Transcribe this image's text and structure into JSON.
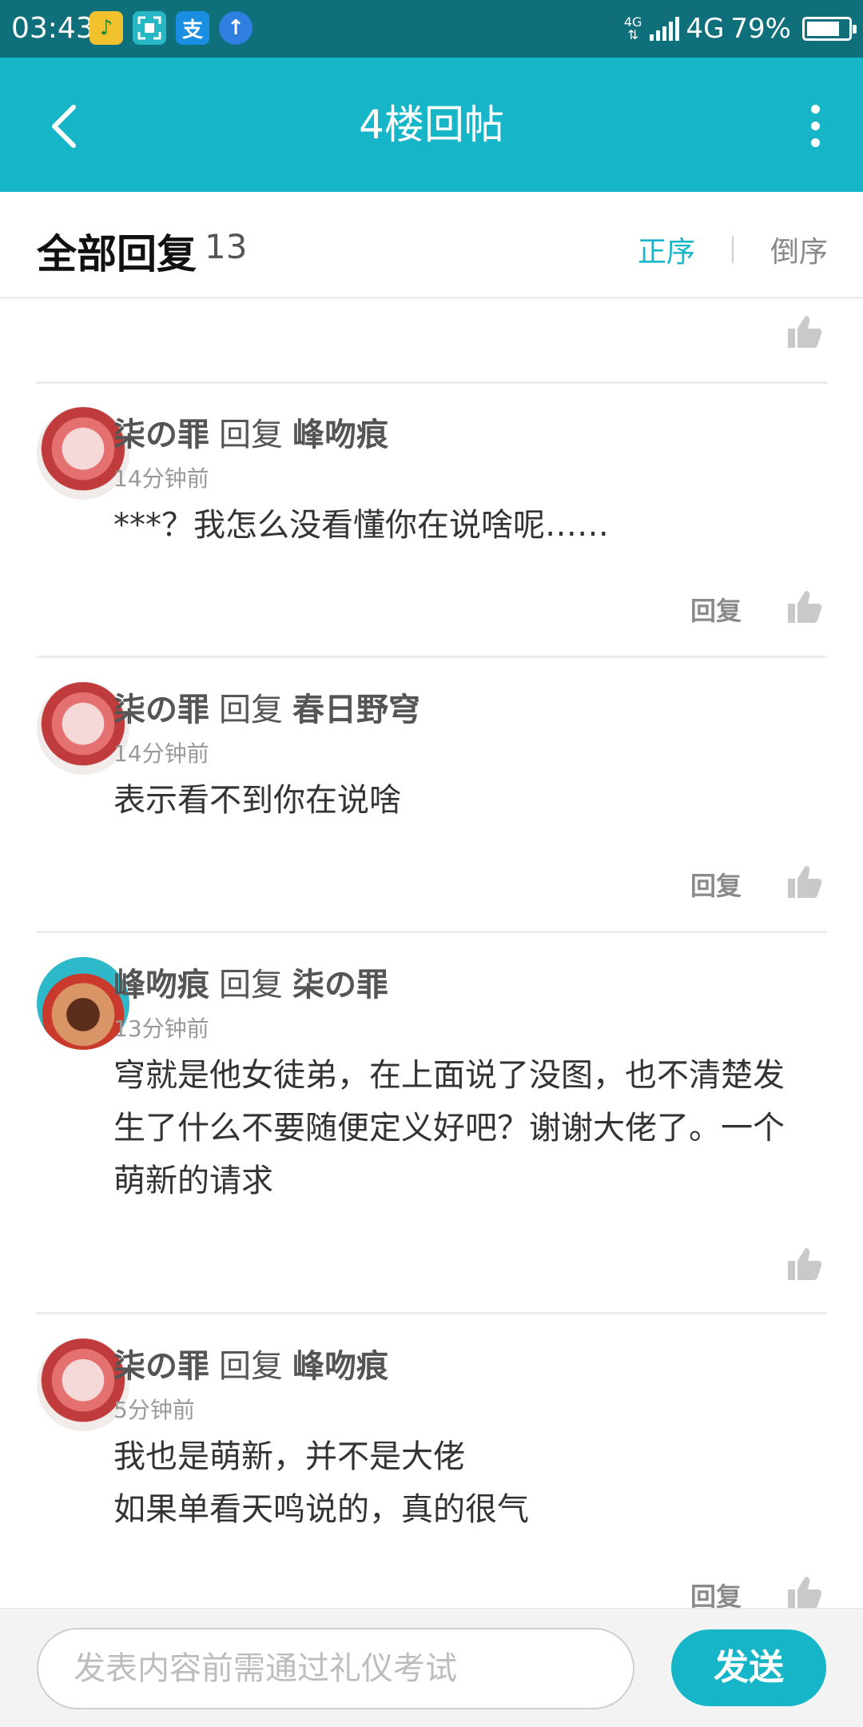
{
  "status_bar": {
    "time": "03:43",
    "network_small": "4G",
    "network": "4G",
    "battery": "79%",
    "battery_level": 0.79,
    "app_icons": [
      "qq-music-icon",
      "scanner-icon",
      "alipay-icon",
      "upload-icon"
    ]
  },
  "title_bar": {
    "title": "4楼回帖"
  },
  "replies_header": {
    "label": "全部回复",
    "count": "13",
    "sort_asc": "正序",
    "sort_desc": "倒序"
  },
  "replies": [
    {
      "user": "柒の罪",
      "reply_word": "回复",
      "target": "峰吻痕",
      "time": "14分钟前",
      "text": "***？我怎么没看懂你在说啥呢……",
      "reply_label": "回复"
    },
    {
      "user": "柒の罪",
      "reply_word": "回复",
      "target": "春日野穹",
      "time": "14分钟前",
      "text": "表示看不到你在说啥",
      "reply_label": "回复"
    },
    {
      "user": "峰吻痕",
      "reply_word": "回复",
      "target": "柒の罪",
      "time": "13分钟前",
      "text": "穹就是他女徒弟，在上面说了没图，也不清楚发生了什么不要随便定义好吧？谢谢大佬了。一个萌新的请求",
      "reply_label": ""
    },
    {
      "user": "柒の罪",
      "reply_word": "回复",
      "target": "峰吻痕",
      "time": "5分钟前",
      "text_lines": [
        "我也是萌新，并不是大佬",
        "如果单看天鸣说的，真的很气"
      ],
      "reply_label": "回复"
    }
  ],
  "composer": {
    "placeholder": "发表内容前需通过礼仪考试",
    "send_label": "发送"
  },
  "colors": {
    "accent": "#16b6c8",
    "status_bar": "#0f6f7a"
  }
}
